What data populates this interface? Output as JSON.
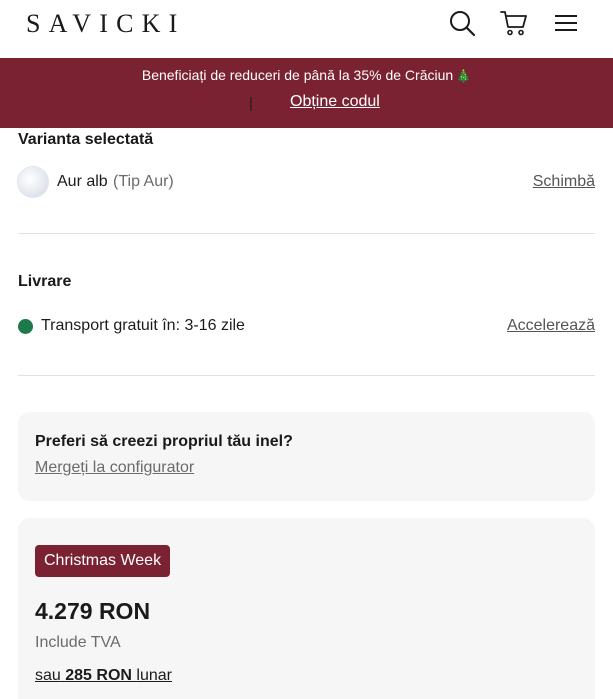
{
  "header": {
    "logo": "SAVICKI",
    "icons": [
      "search-icon",
      "cart-icon",
      "menu-icon"
    ]
  },
  "promo": {
    "text": "Beneficiați de reduceri de până la 35% de Crăciun",
    "emoji": "🎄",
    "separator": "|",
    "link": "Obține codul",
    "background": "#7a2231"
  },
  "variant": {
    "title": "Varianta selectată",
    "name": "Aur alb",
    "type": "(Tip Aur)",
    "change": "Schimbă"
  },
  "delivery": {
    "title": "Livrare",
    "text": "Transport gratuit în: 3-16 zile",
    "link": "Accelerează",
    "status_color": "#1e7a4c"
  },
  "configurator": {
    "title": "Preferi să creezi propriul tău inel?",
    "link": "Mergeți la configurator"
  },
  "price": {
    "badge": "Christmas Week",
    "amount": "4.279 RON",
    "vat": "Include TVA",
    "monthly_prefix": "sau",
    "monthly_amount": "285 RON",
    "monthly_suffix": "lunar"
  }
}
